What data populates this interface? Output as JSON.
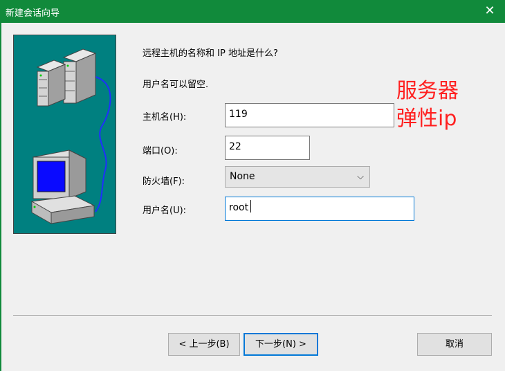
{
  "window": {
    "title": "新建会话向导",
    "close_glyph": "✕"
  },
  "wizard": {
    "question": "远程主机的名称和 IP 地址是什么?",
    "hint": "用户名可以留空.",
    "fields": {
      "host": {
        "label": "主机名(H):",
        "value": "119"
      },
      "port": {
        "label": "端口(O):",
        "value": "22"
      },
      "firewall": {
        "label": "防火墙(F):",
        "value": "None"
      },
      "username": {
        "label": "用户名(U):",
        "value": "root"
      }
    }
  },
  "annotation": {
    "line1": "服务器",
    "line2": "弹性ip"
  },
  "buttons": {
    "back": "< 上一步(B)",
    "next": "下一步(N) >",
    "cancel": "取消"
  },
  "colors": {
    "titlebar": "#118a3b",
    "art_bg": "#008080",
    "focus": "#0078d7",
    "annotation": "#ff2020"
  }
}
